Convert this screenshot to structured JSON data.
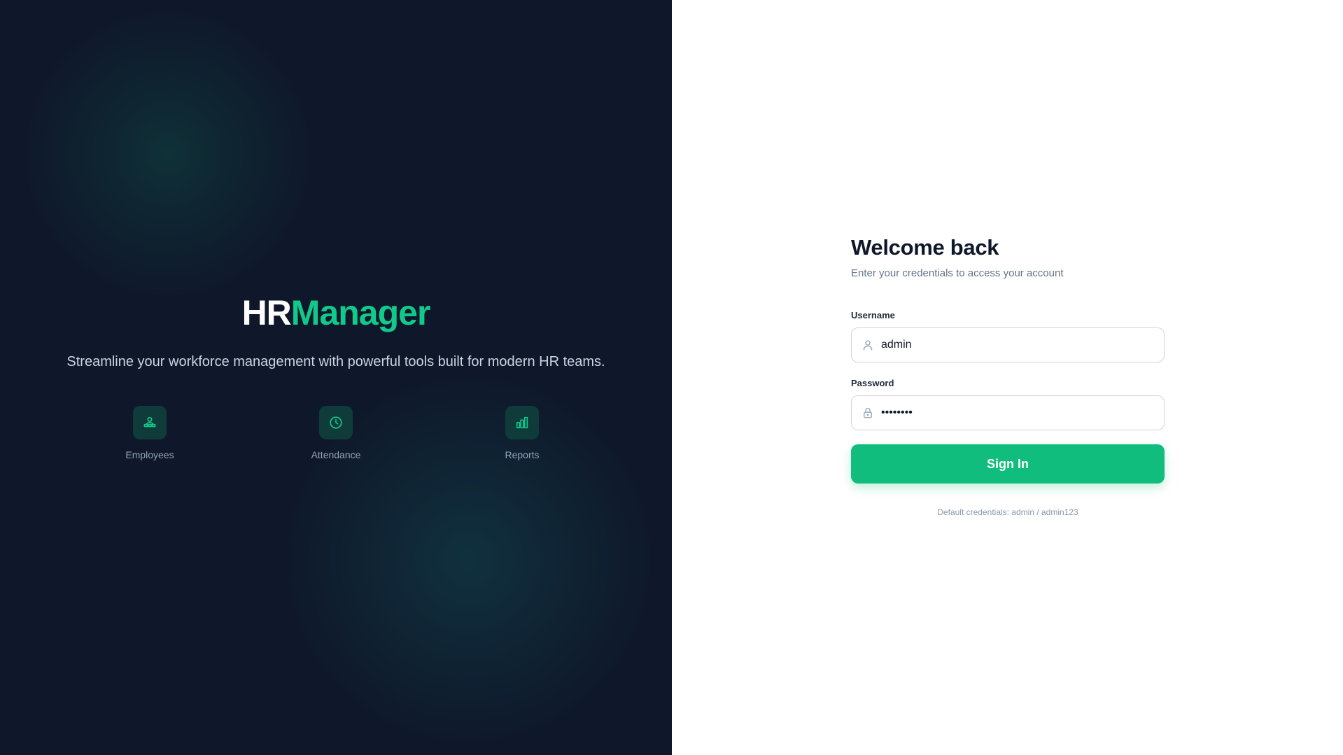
{
  "brand": {
    "prefix": "HR",
    "suffix": "Manager",
    "tagline": "Streamline your workforce management with powerful tools built for modern HR teams."
  },
  "features": [
    {
      "label": "Employees",
      "icon": "users-icon"
    },
    {
      "label": "Attendance",
      "icon": "clock-icon"
    },
    {
      "label": "Reports",
      "icon": "bar-chart-icon"
    }
  ],
  "login": {
    "title": "Welcome back",
    "subtitle": "Enter your credentials to access your account",
    "username_label": "Username",
    "username_value": "admin",
    "password_label": "Password",
    "password_value": "admin123",
    "submit_label": "Sign In",
    "hint": "Default credentials: admin / admin123"
  },
  "colors": {
    "left_bg": "#0f172a",
    "accent": "#10bd7d",
    "brand_green": "#10c98a"
  }
}
